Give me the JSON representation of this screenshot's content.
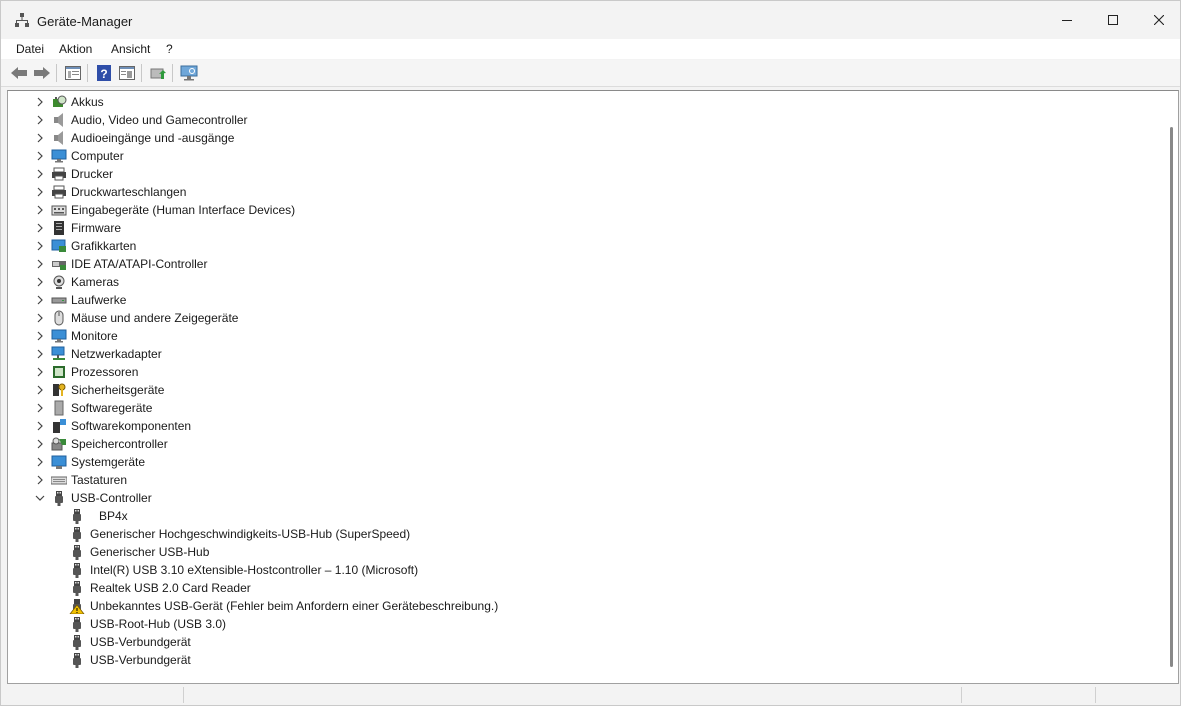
{
  "window": {
    "title": "Geräte-Manager"
  },
  "menu": {
    "items": [
      "Datei",
      "Aktion",
      "Ansicht",
      "?"
    ]
  },
  "toolbar": {
    "buttons": [
      "back-icon",
      "forward-icon",
      "properties-view-icon",
      "help-icon",
      "show-hidden-icon",
      "update-driver-icon",
      "scan-hardware-icon"
    ]
  },
  "tree": {
    "categories": [
      {
        "label": "Akkus",
        "icon": "battery-icon"
      },
      {
        "label": "Audio, Video und Gamecontroller",
        "icon": "speaker-icon"
      },
      {
        "label": "Audioeingänge und -ausgänge",
        "icon": "speaker-icon"
      },
      {
        "label": "Computer",
        "icon": "monitor-icon"
      },
      {
        "label": "Drucker",
        "icon": "printer-icon"
      },
      {
        "label": "Druckwarteschlangen",
        "icon": "printer-icon"
      },
      {
        "label": "Eingabegeräte (Human Interface Devices)",
        "icon": "hid-icon"
      },
      {
        "label": "Firmware",
        "icon": "firmware-icon"
      },
      {
        "label": "Grafikkarten",
        "icon": "display-adapter-icon"
      },
      {
        "label": "IDE ATA/ATAPI-Controller",
        "icon": "ide-icon"
      },
      {
        "label": "Kameras",
        "icon": "camera-icon"
      },
      {
        "label": "Laufwerke",
        "icon": "drive-icon"
      },
      {
        "label": "Mäuse und andere Zeigegeräte",
        "icon": "mouse-icon"
      },
      {
        "label": "Monitore",
        "icon": "monitor-icon"
      },
      {
        "label": "Netzwerkadapter",
        "icon": "network-icon"
      },
      {
        "label": "Prozessoren",
        "icon": "processor-icon"
      },
      {
        "label": "Sicherheitsgeräte",
        "icon": "security-key-icon"
      },
      {
        "label": "Softwaregeräte",
        "icon": "software-device-icon"
      },
      {
        "label": "Softwarekomponenten",
        "icon": "software-component-icon"
      },
      {
        "label": "Speichercontroller",
        "icon": "storage-controller-icon"
      },
      {
        "label": "Systemgeräte",
        "icon": "system-device-icon"
      },
      {
        "label": "Tastaturen",
        "icon": "keyboard-icon"
      },
      {
        "label": "USB-Controller",
        "icon": "usb-icon",
        "expanded": true,
        "children": [
          {
            "label": "BP4x",
            "icon": "usb-icon",
            "indent_extra": true
          },
          {
            "label": "Generischer Hochgeschwindigkeits-USB-Hub (SuperSpeed)",
            "icon": "usb-icon"
          },
          {
            "label": "Generischer USB-Hub",
            "icon": "usb-icon"
          },
          {
            "label": "Intel(R) USB 3.10 eXtensible-Hostcontroller – 1.10 (Microsoft)",
            "icon": "usb-icon"
          },
          {
            "label": "Realtek USB 2.0 Card Reader",
            "icon": "usb-icon"
          },
          {
            "label": "Unbekanntes USB-Gerät (Fehler beim Anfordern einer Gerätebeschreibung.)",
            "icon": "usb-warning-icon"
          },
          {
            "label": "USB-Root-Hub (USB 3.0)",
            "icon": "usb-icon"
          },
          {
            "label": "USB-Verbundgerät",
            "icon": "usb-icon"
          },
          {
            "label": "USB-Verbundgerät",
            "icon": "usb-icon"
          }
        ]
      }
    ]
  }
}
